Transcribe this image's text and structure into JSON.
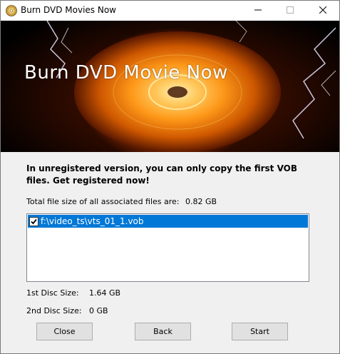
{
  "window": {
    "title": "Burn DVD Movies Now",
    "icon": "dvd-disc-icon",
    "controls": [
      "minimize-icon",
      "maximize-icon",
      "close-icon"
    ]
  },
  "banner": {
    "title": "Burn DVD Movie Now"
  },
  "notice": {
    "text": "In unregistered version, you can only copy the first VOB files. Get registered now!"
  },
  "total_size": {
    "label": "Total file size of all associated files are:",
    "value": "0.82 GB"
  },
  "file_list": {
    "items": [
      {
        "path": "f:\\video_ts\\vts_01_1.vob",
        "checked": true
      }
    ]
  },
  "disc1": {
    "label": "1st Disc Size:",
    "value": "1.64 GB"
  },
  "disc2": {
    "label": "2nd Disc Size:",
    "value": "0 GB"
  },
  "buttons": {
    "close": "Close",
    "back": "Back",
    "start": "Start"
  },
  "colors": {
    "selection": "#0078d7",
    "banner_glow": "#ff9a1a"
  }
}
